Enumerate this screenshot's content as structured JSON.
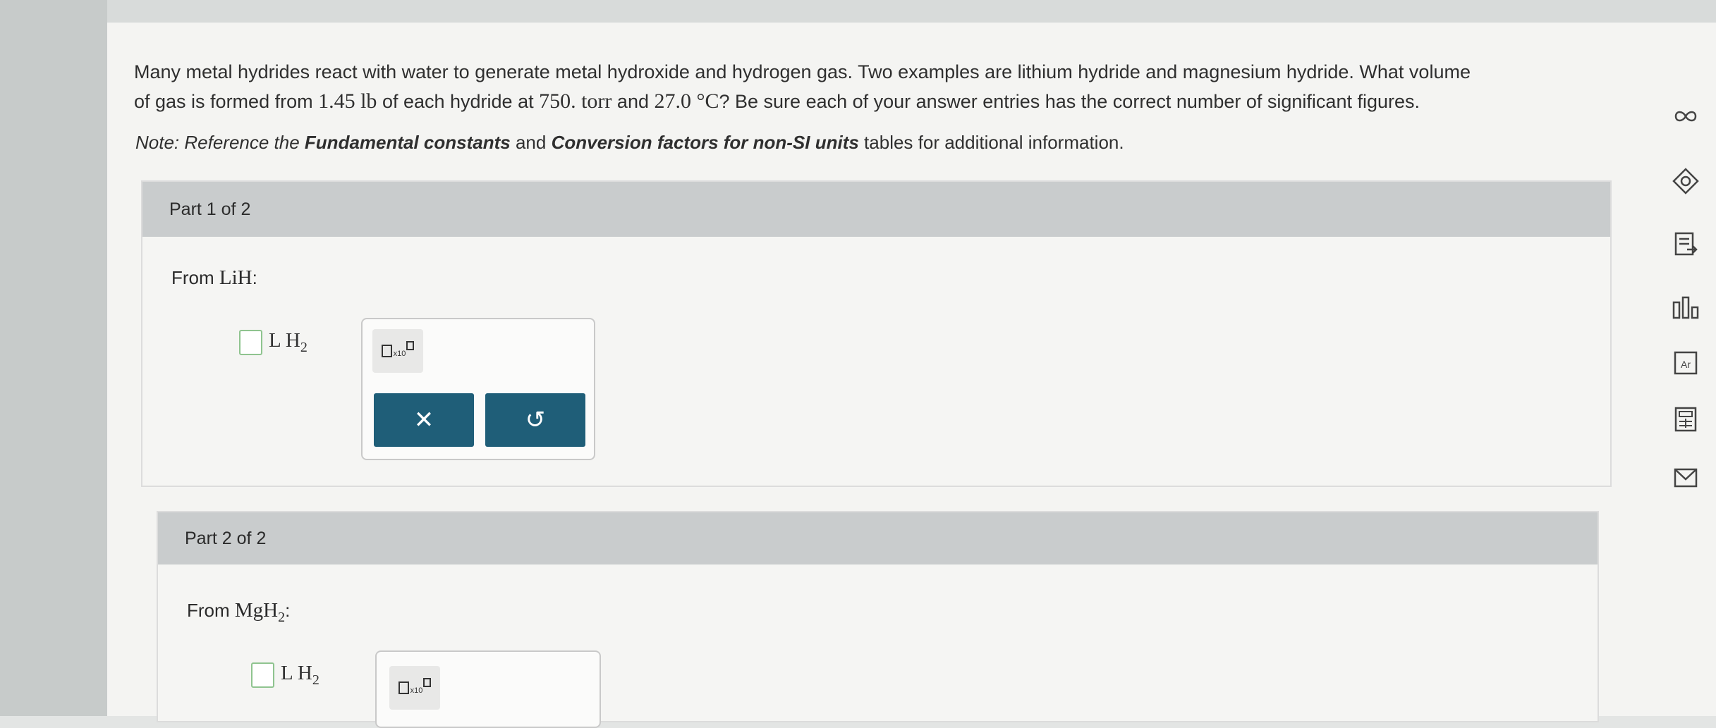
{
  "question": {
    "text_1": "Many metal hydrides react with water to generate metal hydroxide and hydrogen gas. Two examples are lithium hydride and magnesium hydride. What volume",
    "text_2": "of gas is formed from ",
    "mass": "1.45 lb",
    "text_3": " of each hydride at ",
    "pressure": "750. torr",
    "text_4": " and ",
    "temperature": "27.0 °C",
    "text_5": "? Be sure each of your answer entries has the correct number of significant figures."
  },
  "note": {
    "prefix": "Note: Reference the ",
    "table_1": "Fundamental constants",
    "middle": " and ",
    "table_2": "Conversion factors for non-SI units",
    "suffix": " tables for additional information."
  },
  "parts": [
    {
      "header": "Part 1 of 2",
      "from_label": "From ",
      "compound": "LiH",
      "compound_sub": "",
      "colon": ":",
      "unit": "L H",
      "unit_sub": "2"
    },
    {
      "header": "Part 2 of 2",
      "from_label": "From ",
      "compound": "MgH",
      "compound_sub": "2",
      "colon": ":",
      "unit": "L H",
      "unit_sub": "2"
    }
  ],
  "tools": {
    "x10_label": "x10",
    "clear_symbol": "✕",
    "undo_symbol": "↺"
  },
  "toolbar_icons": [
    "infinity-icon",
    "hint-icon",
    "worksheet-icon",
    "chart-icon",
    "periodic-table-icon",
    "calculator-icon",
    "email-icon"
  ],
  "colors": {
    "accent": "#1f5e78",
    "answer_box_border": "#8fc48f",
    "part_header": "#c9cccd"
  }
}
